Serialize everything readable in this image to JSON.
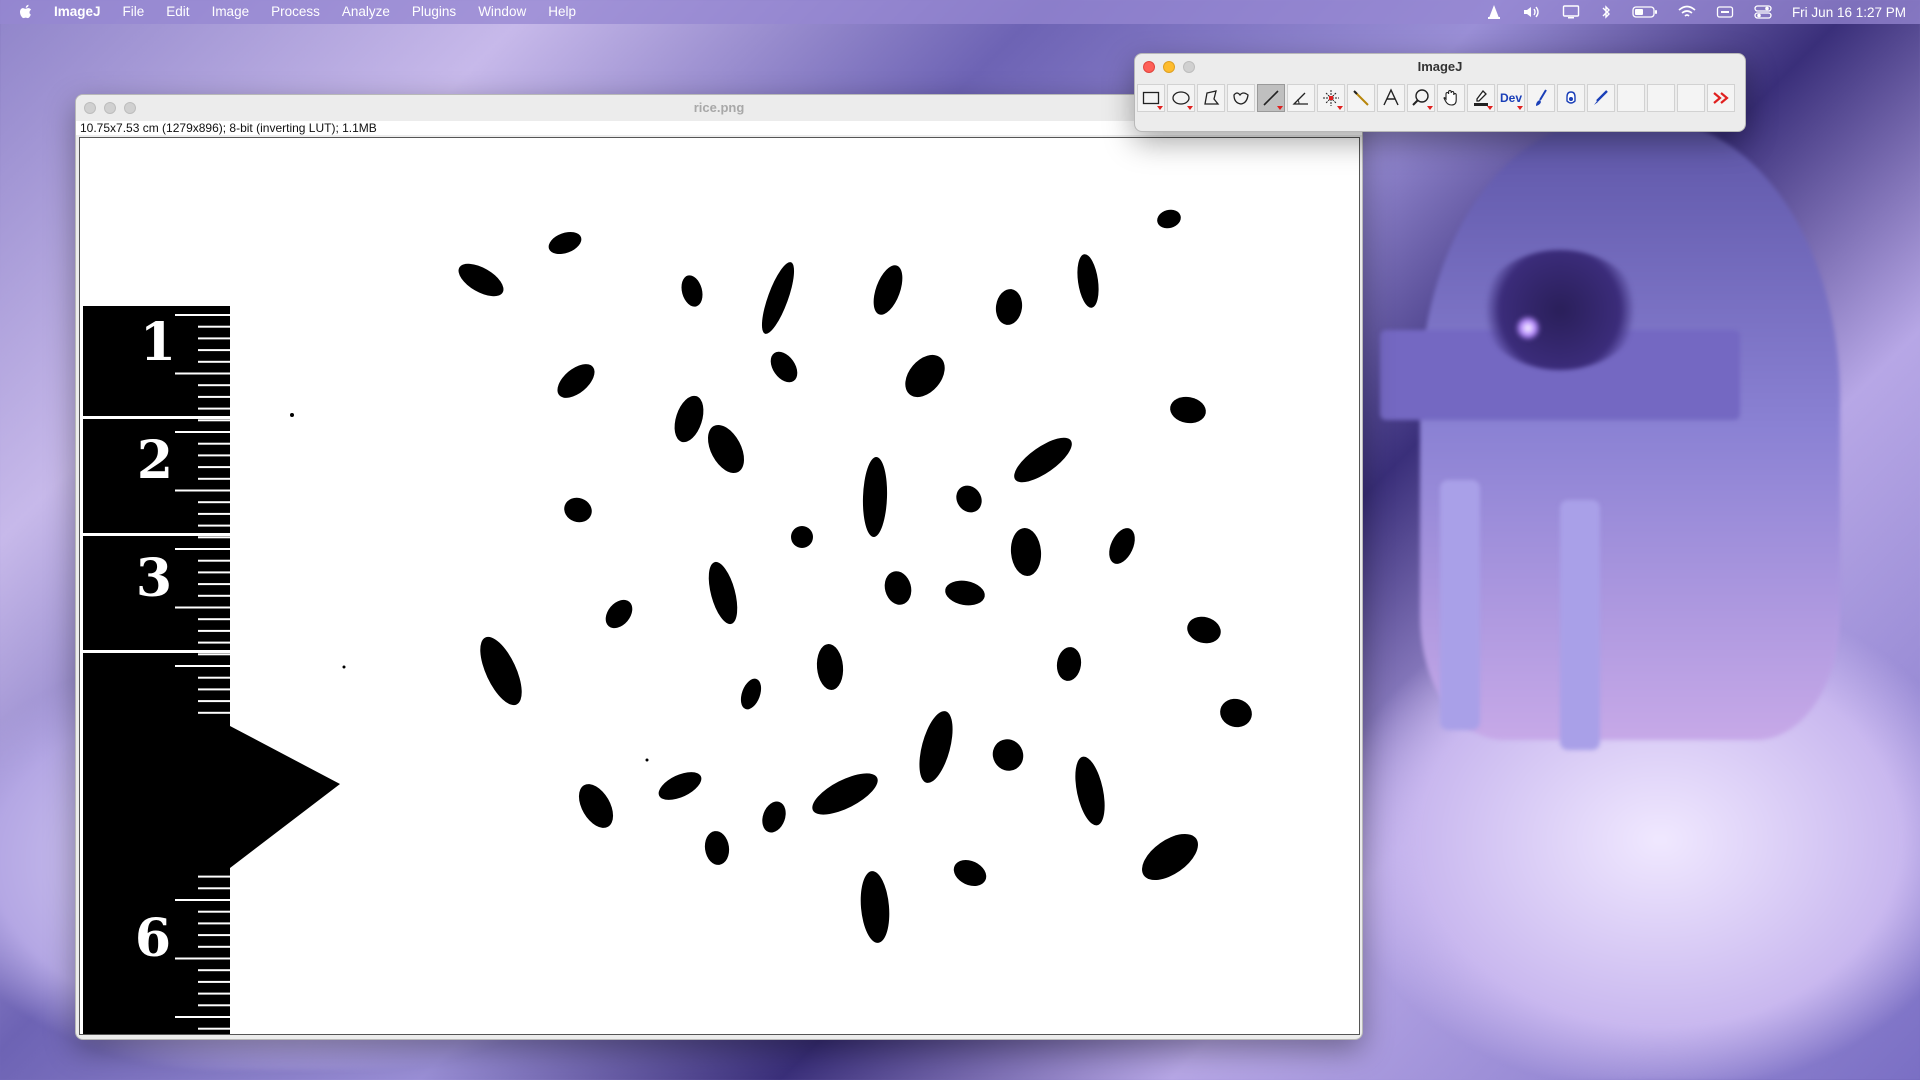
{
  "menubar": {
    "app_name": "ImageJ",
    "items": [
      "File",
      "Edit",
      "Image",
      "Process",
      "Analyze",
      "Plugins",
      "Window",
      "Help"
    ],
    "clock": "Fri Jun 16  1:27 PM",
    "status_icons": [
      "vlc-icon",
      "volume-icon",
      "display-icon",
      "bluetooth-icon",
      "battery-icon",
      "wifi-icon",
      "keyboard-input-icon",
      "control-center-icon"
    ]
  },
  "image_window": {
    "title": "rice.png",
    "info": "10.75x7.53 cm (1279x896); 8-bit (inverting LUT); 1.1MB",
    "ruler_labels": [
      "1",
      "2",
      "3",
      "6"
    ]
  },
  "toolbar_window": {
    "title": "ImageJ",
    "tools": [
      {
        "name": "rectangle-tool-icon",
        "has_menu": true
      },
      {
        "name": "oval-tool-icon",
        "has_menu": true
      },
      {
        "name": "polygon-tool-icon",
        "has_menu": false
      },
      {
        "name": "freehand-tool-icon",
        "has_menu": false
      },
      {
        "name": "line-tool-icon",
        "has_menu": true,
        "selected": true
      },
      {
        "name": "angle-tool-icon",
        "has_menu": false
      },
      {
        "name": "point-tool-icon",
        "has_menu": true
      },
      {
        "name": "wand-tool-icon",
        "has_menu": false
      },
      {
        "name": "text-tool-icon",
        "has_menu": false
      },
      {
        "name": "magnifier-tool-icon",
        "has_menu": true
      },
      {
        "name": "hand-tool-icon",
        "has_menu": false
      },
      {
        "name": "dropper-tool-icon",
        "has_menu": true
      },
      {
        "name": "dev-tool",
        "label": "Dev",
        "has_menu": true
      },
      {
        "name": "brush-tool-icon",
        "has_menu": false
      },
      {
        "name": "flood-fill-tool-icon",
        "has_menu": false
      },
      {
        "name": "pencil-tool-icon",
        "has_menu": false
      },
      {
        "name": "empty-slot",
        "has_menu": false
      },
      {
        "name": "empty-slot",
        "has_menu": false
      },
      {
        "name": "empty-slot",
        "has_menu": false
      },
      {
        "name": "more-tools-icon",
        "has_menu": false
      }
    ]
  },
  "colors": {
    "menubar_bg": "#9687d2",
    "window_bg": "#ececec",
    "close": "#fe5f57",
    "minimize": "#febc2e",
    "tool_menu_marker": "#e0201f",
    "dev_label": "#1a3fb8"
  }
}
